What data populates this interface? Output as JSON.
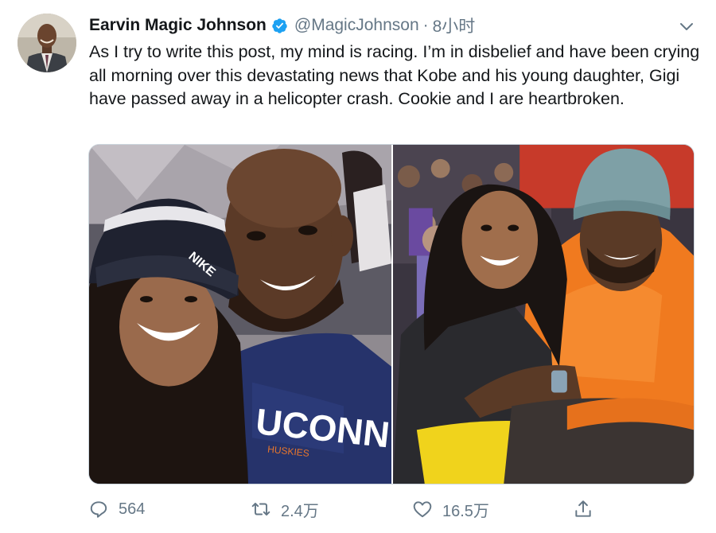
{
  "tweet": {
    "display_name": "Earvin Magic Johnson",
    "verified": true,
    "handle": "@MagicJohnson",
    "separator": "·",
    "time": "8小时",
    "text": "As I try to write this post, my mind is racing. I’m in disbelief and have been crying all morning over this devastating news that Kobe and his young daughter, Gigi have passed away in a helicopter crash. Cookie and I are heartbroken.",
    "media": [
      {
        "icon": "photo-selfie",
        "cap_text": "NIKE",
        "shirt_text": "UCONN",
        "shirt_subtext": "HUSKIES"
      },
      {
        "icon": "photo-courtside"
      }
    ],
    "actions": {
      "reply_count": "564",
      "retweet_count": "2.4万",
      "like_count": "16.5万"
    }
  },
  "colors": {
    "verified": "#1da1f2",
    "secondary_text": "#657786",
    "primary_text": "#14171a",
    "border": "#ccd6dd"
  }
}
